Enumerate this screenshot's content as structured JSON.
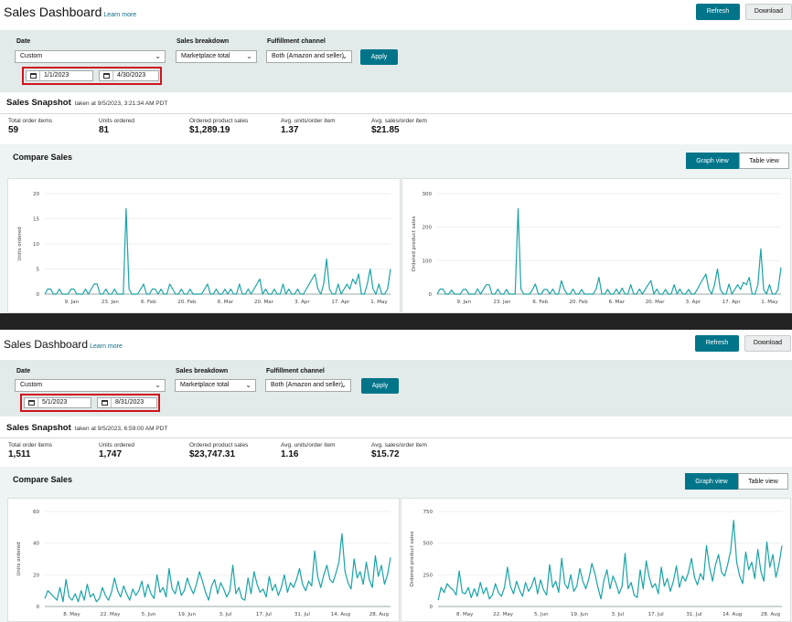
{
  "colors": {
    "accent": "#00758a",
    "series": "#1aa3a6",
    "highlight": "#d0141d",
    "filter_bg": "#e3eaea"
  },
  "panels": [
    {
      "header": {
        "title": "Sales Dashboard",
        "learn_more": "Learn more",
        "refresh": "Refresh",
        "download": "Download"
      },
      "filters": {
        "date_label": "Date",
        "date_value": "Custom",
        "start_date": "1/1/2023",
        "end_date": "4/30/2023",
        "breakdown_label": "Sales breakdown",
        "breakdown_value": "Marketplace total",
        "fulfillment_label": "Fulfillment channel",
        "fulfillment_value": "Both (Amazon and seller)",
        "apply": "Apply"
      },
      "snapshot": {
        "title": "Sales Snapshot",
        "taken_at": "taken at 9/5/2023, 3:21:34 AM PDT",
        "metrics": [
          {
            "label": "Total order items",
            "value": "59"
          },
          {
            "label": "Units ordered",
            "value": "81"
          },
          {
            "label": "Ordered product sales",
            "value": "$1,289.19"
          },
          {
            "label": "Avg. units/order item",
            "value": "1.37"
          },
          {
            "label": "Avg. sales/order item",
            "value": "$21.85"
          }
        ]
      },
      "compare": {
        "title": "Compare Sales",
        "graph_view": "Graph view",
        "table_view": "Table view"
      }
    },
    {
      "header": {
        "title": "Sales Dashboard",
        "learn_more": "Learn more",
        "refresh": "Refresh",
        "download": "Download"
      },
      "filters": {
        "date_label": "Date",
        "date_value": "Custom",
        "start_date": "5/1/2023",
        "end_date": "8/31/2023",
        "breakdown_label": "Sales breakdown",
        "breakdown_value": "Marketplace total",
        "fulfillment_label": "Fulfillment channel",
        "fulfillment_value": "Both (Amazon and seller)",
        "apply": "Apply"
      },
      "snapshot": {
        "title": "Sales Snapshot",
        "taken_at": "taken at 9/5/2023, 6:59:00 AM PDT",
        "metrics": [
          {
            "label": "Total order items",
            "value": "1,511"
          },
          {
            "label": "Units ordered",
            "value": "1,747"
          },
          {
            "label": "Ordered product sales",
            "value": "$23,747.31"
          },
          {
            "label": "Avg. units/order item",
            "value": "1.16"
          },
          {
            "label": "Avg. sales/order item",
            "value": "$15.72"
          }
        ]
      },
      "compare": {
        "title": "Compare Sales",
        "graph_view": "Graph view",
        "table_view": "Table view"
      }
    }
  ],
  "chart_data": [
    {
      "type": "line",
      "ylabel": "Units ordered",
      "ylim": [
        0,
        20
      ],
      "yticks": [
        "0",
        "5",
        "10",
        "15",
        "20"
      ],
      "xticks": [
        "9. Jan",
        "23. Jan",
        "6. Feb",
        "20. Feb",
        "6. Mar",
        "20. Mar",
        "3. Apr",
        "17. Apr",
        "1. May"
      ],
      "values": [
        0,
        1,
        1,
        0,
        0,
        1,
        0,
        0,
        0,
        1,
        1,
        0,
        0,
        0,
        1,
        0,
        1,
        2,
        2,
        0,
        0,
        1,
        0,
        0,
        1,
        0,
        0,
        0,
        17,
        1,
        0,
        0,
        0,
        1,
        2,
        0,
        0,
        1,
        1,
        0,
        1,
        0,
        0,
        2,
        1,
        0,
        0,
        1,
        0,
        0,
        1,
        0,
        0,
        0,
        0,
        1,
        2,
        0,
        0,
        1,
        0,
        0,
        1,
        0,
        1,
        0,
        0,
        2,
        0,
        0,
        1,
        0,
        1,
        2,
        3,
        0,
        1,
        0,
        0,
        1,
        0,
        0,
        2,
        0,
        1,
        0,
        0,
        1,
        0,
        0,
        1,
        2,
        3,
        4,
        1,
        0,
        2,
        7,
        1,
        0,
        0,
        2,
        0,
        1,
        2,
        1,
        3,
        2,
        4,
        0,
        0,
        2,
        5,
        1,
        0,
        2,
        0,
        0,
        1,
        5
      ]
    },
    {
      "type": "line",
      "ylabel": "Ordered product sales",
      "ylim": [
        0,
        300
      ],
      "yticks": [
        "0",
        "100",
        "200",
        "300"
      ],
      "xticks": [
        "9. Jan",
        "23. Jan",
        "6. Feb",
        "20. Feb",
        "6. Mar",
        "20. Mar",
        "3. Apr",
        "17. Apr",
        "1. May"
      ],
      "values": [
        0,
        15,
        15,
        0,
        0,
        12,
        0,
        0,
        0,
        14,
        14,
        0,
        0,
        0,
        16,
        0,
        14,
        28,
        28,
        0,
        0,
        15,
        0,
        0,
        14,
        0,
        0,
        0,
        255,
        15,
        0,
        0,
        0,
        14,
        30,
        0,
        0,
        14,
        14,
        0,
        15,
        0,
        0,
        40,
        14,
        0,
        0,
        15,
        0,
        0,
        14,
        0,
        0,
        0,
        0,
        15,
        50,
        0,
        0,
        14,
        0,
        0,
        15,
        0,
        18,
        0,
        0,
        28,
        0,
        0,
        15,
        0,
        14,
        28,
        40,
        0,
        15,
        0,
        0,
        14,
        0,
        0,
        28,
        0,
        15,
        0,
        0,
        14,
        0,
        0,
        14,
        30,
        45,
        60,
        15,
        0,
        28,
        75,
        14,
        0,
        0,
        30,
        0,
        14,
        28,
        14,
        35,
        28,
        50,
        0,
        0,
        28,
        135,
        14,
        0,
        28,
        0,
        0,
        14,
        80
      ]
    },
    {
      "type": "line",
      "ylabel": "Units ordered",
      "ylim": [
        0,
        60
      ],
      "yticks": [
        "0",
        "20",
        "40",
        "60"
      ],
      "xticks": [
        "8. May",
        "22. May",
        "5. Jun",
        "19. Jun",
        "3. Jul",
        "17. Jul",
        "31. Jul",
        "14. Aug",
        "28. Aug"
      ],
      "values": [
        5,
        10,
        8,
        6,
        4,
        12,
        3,
        17,
        6,
        4,
        8,
        3,
        10,
        4,
        14,
        6,
        8,
        3,
        5,
        12,
        7,
        4,
        9,
        18,
        10,
        6,
        13,
        8,
        4,
        11,
        7,
        10,
        16,
        6,
        14,
        8,
        5,
        20,
        9,
        12,
        6,
        24,
        11,
        8,
        16,
        7,
        10,
        18,
        12,
        8,
        14,
        22,
        16,
        9,
        4,
        13,
        17,
        8,
        15,
        11,
        6,
        10,
        26,
        8,
        12,
        5,
        4,
        18,
        8,
        22,
        14,
        9,
        11,
        6,
        19,
        10,
        14,
        7,
        12,
        20,
        9,
        15,
        12,
        17,
        24,
        14,
        10,
        16,
        13,
        35,
        19,
        12,
        20,
        26,
        17,
        15,
        21,
        28,
        46,
        22,
        15,
        11,
        30,
        18,
        22,
        14,
        28,
        17,
        12,
        32,
        19,
        26,
        14,
        20,
        31
      ]
    },
    {
      "type": "line",
      "ylabel": "Ordered product sales",
      "ylim": [
        0,
        750
      ],
      "yticks": [
        "0",
        "250",
        "500",
        "750"
      ],
      "xticks": [
        "8. May",
        "22. May",
        "5. Jun",
        "19. Jun",
        "3. Jul",
        "17. Jul",
        "31. Jul",
        "14. Aug",
        "28. Aug"
      ],
      "values": [
        50,
        150,
        110,
        180,
        150,
        130,
        90,
        280,
        110,
        100,
        150,
        70,
        140,
        80,
        190,
        100,
        150,
        60,
        90,
        180,
        110,
        80,
        150,
        310,
        160,
        100,
        200,
        130,
        80,
        190,
        120,
        160,
        230,
        100,
        210,
        130,
        90,
        330,
        150,
        200,
        110,
        380,
        180,
        140,
        250,
        120,
        160,
        300,
        200,
        140,
        220,
        340,
        260,
        150,
        60,
        210,
        290,
        140,
        240,
        180,
        100,
        160,
        420,
        140,
        190,
        90,
        70,
        290,
        140,
        360,
        230,
        150,
        180,
        100,
        310,
        160,
        220,
        120,
        200,
        320,
        150,
        240,
        200,
        270,
        380,
        230,
        170,
        260,
        210,
        480,
        310,
        200,
        330,
        410,
        270,
        240,
        330,
        440,
        680,
        350,
        240,
        180,
        430,
        290,
        350,
        220,
        450,
        280,
        200,
        510,
        310,
        410,
        230,
        330,
        480
      ]
    }
  ]
}
